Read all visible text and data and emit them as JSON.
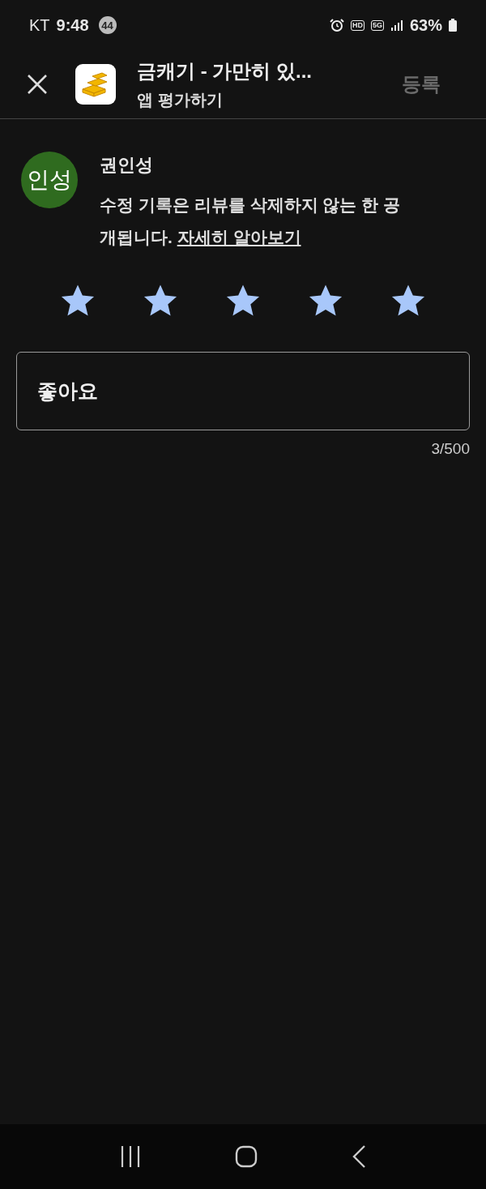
{
  "status_bar": {
    "carrier": "KT",
    "time": "9:48",
    "notification_count": "44",
    "hd_label": "HD",
    "network_label": "5G",
    "battery": "63%"
  },
  "header": {
    "title": "금캐기 - 가만히 있...",
    "subtitle": "앱 평가하기",
    "submit_button": {
      "label": "등록",
      "disabled": true
    }
  },
  "review": {
    "avatar_initials": "인성",
    "user_name": "권인성",
    "notice": "수정 기록은 리뷰를 삭제하지 않는 한 공개됩니다.",
    "notice_link": "자세히 알아보기",
    "stars": 5,
    "text_value": "좋아요",
    "char_count": "3/500"
  }
}
